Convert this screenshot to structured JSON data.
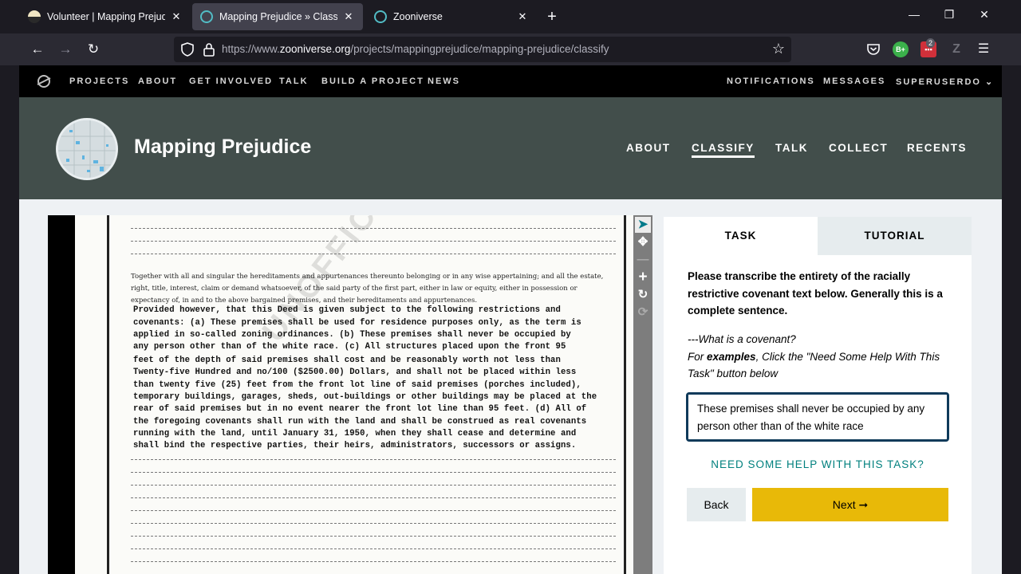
{
  "browser": {
    "tabs": [
      {
        "title": "Volunteer | Mapping Prejudice",
        "close": "✕"
      },
      {
        "title": "Mapping Prejudice » Classify —",
        "close": "✕"
      },
      {
        "title": "Zooniverse",
        "close": "✕"
      }
    ],
    "new_tab": "+",
    "window_controls": {
      "minimize": "—",
      "maximize": "❐",
      "close": "✕"
    },
    "url_prefix": "https://www.",
    "url_domain": "zooniverse.org",
    "url_path": "/projects/mappingprejudice/mapping-prejudice/classify",
    "extensions": {
      "b_badge": "B+",
      "red_badge_count": "2",
      "z_badge": "Z"
    }
  },
  "zooniverse_nav": {
    "left": [
      "PROJECTS",
      "ABOUT",
      "GET INVOLVED",
      "TALK",
      "BUILD A PROJECT",
      "NEWS"
    ],
    "right": {
      "notifications": "NOTIFICATIONS",
      "messages": "MESSAGES",
      "user": "SUPERUSERDO"
    }
  },
  "project": {
    "title": "Mapping Prejudice",
    "links": [
      "ABOUT",
      "CLASSIFY",
      "TALK",
      "COLLECT",
      "RECENTS"
    ],
    "active_link": "CLASSIFY"
  },
  "document": {
    "watermark": "UNOFFICIAL",
    "printed_paragraph": "Together with all and singular the hereditaments and appurtenances thereunto belonging or in any wise appertaining; and all the estate, right, title, interest, claim or demand whatsoever, of the said party of the first part, either in law or equity, either in possession or expectancy of, in and to the above bargained premises, and their hereditaments and appurtenances.",
    "typed_lines": [
      "Provided however, that this Deed is given subject to the following restrictions and",
      "covenants: (a) These premises shall be used for residence purposes only, as the term is",
      "applied in so-called zoning ordinances. (b) These premises shall never be occupied by",
      "any person other than of the white race. (c) All structures placed upon the front 95",
      "feet of the depth of said premises shall cost and be reasonably worth not less than",
      "Twenty-five Hundred and no/100 ($2500.00) Dollars, and shall not be placed within less",
      "than twenty five (25) feet from the front lot line of said premises (porches included),",
      "temporary buildings, garages, sheds, out-buildings or other buildings may be placed at the",
      "rear of said premises but in no event nearer the front lot line than 95 feet. (d) All of",
      "the foregoing covenants shall run with the land and shall be construed as real covenants",
      "running with the land, until January 31, 1950, when they shall cease and determine and",
      "shall bind the respective parties, their heirs, administrators, successors or assigns."
    ]
  },
  "viewer_tools": {
    "pointer": "➤",
    "move": "✥",
    "zoom_out": "—",
    "zoom_in": "+",
    "rotate": "↻",
    "reset": "⟳"
  },
  "task": {
    "tab_task": "TASK",
    "tab_tutorial": "TUTORIAL",
    "instruction": "Please transcribe the entirety of the racially restrictive covenant text below. Generally this is a complete sentence.",
    "hint_line1": "---What is a covenant?",
    "hint_for": "For ",
    "hint_examples": "examples",
    "hint_rest": ", Click the \"Need Some Help With This Task\" button below",
    "input_value": "These premises shall never be occupied by any person other than of the white race",
    "help_link": "NEED SOME HELP WITH THIS TASK?",
    "back_label": "Back",
    "next_label": "Next ➞"
  },
  "colors": {
    "header_bg": "#424e4b",
    "next_button": "#e8b908",
    "help_link": "#00807e",
    "input_border": "#0f3a5a"
  }
}
